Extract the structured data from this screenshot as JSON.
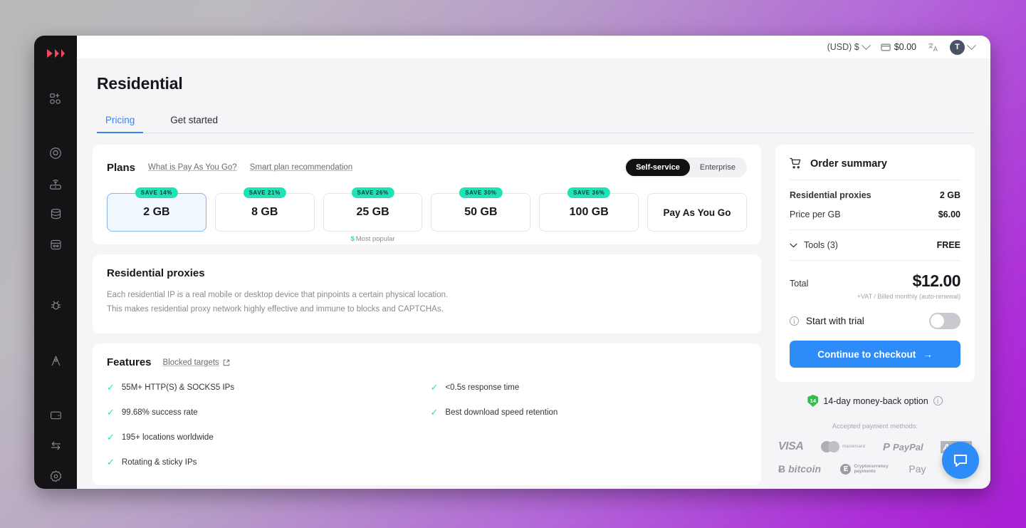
{
  "topbar": {
    "currency": "(USD) $",
    "balance": "$0.00",
    "language_icon": "translate-icon",
    "avatar_initial": "T"
  },
  "sidebar": {
    "logo": "brand-logo",
    "items": [
      {
        "icon": "add-user-icon",
        "name": "sidebar-item-add-user"
      },
      {
        "icon": "target-location-icon",
        "name": "sidebar-item-proxies"
      },
      {
        "icon": "router-icon",
        "name": "sidebar-item-network"
      },
      {
        "icon": "database-icon",
        "name": "sidebar-item-datacenter"
      },
      {
        "icon": "scraper-icon",
        "name": "sidebar-item-scraper"
      },
      {
        "icon": "bug-icon",
        "name": "sidebar-item-debug"
      },
      {
        "icon": "compass-icon",
        "name": "sidebar-item-explore"
      },
      {
        "icon": "wallet-icon",
        "name": "sidebar-item-billing"
      },
      {
        "icon": "transfer-icon",
        "name": "sidebar-item-transfer"
      },
      {
        "icon": "gear-icon",
        "name": "sidebar-item-settings"
      }
    ]
  },
  "page": {
    "title": "Residential",
    "tabs": [
      {
        "label": "Pricing",
        "active": true
      },
      {
        "label": "Get started",
        "active": false
      }
    ]
  },
  "plans": {
    "title": "Plans",
    "links": [
      {
        "label": "What is Pay As You Go?"
      },
      {
        "label": "Smart plan recommendation"
      }
    ],
    "segments": [
      {
        "label": "Self-service",
        "active": true
      },
      {
        "label": "Enterprise",
        "active": false
      }
    ],
    "options": [
      {
        "label": "2 GB",
        "badge": "SAVE 14%",
        "selected": true,
        "note": ""
      },
      {
        "label": "8 GB",
        "badge": "SAVE 21%",
        "selected": false,
        "note": ""
      },
      {
        "label": "25 GB",
        "badge": "SAVE 26%",
        "selected": false,
        "note": "Most popular"
      },
      {
        "label": "50 GB",
        "badge": "SAVE 30%",
        "selected": false,
        "note": ""
      },
      {
        "label": "100 GB",
        "badge": "SAVE 36%",
        "selected": false,
        "note": ""
      },
      {
        "label": "Pay As You Go",
        "badge": "",
        "selected": false,
        "note": ""
      }
    ]
  },
  "product": {
    "title": "Residential proxies",
    "line1": "Each residential IP is a real mobile or desktop device that pinpoints a certain physical location.",
    "line2": "This makes residential proxy network highly effective and immune to blocks and CAPTCHAs."
  },
  "features": {
    "title": "Features",
    "link": "Blocked targets",
    "items": [
      "55M+ HTTP(S) & SOCKS5 IPs",
      "<0.5s response time",
      "99.68% success rate",
      "Best download speed retention",
      "195+ locations worldwide",
      "Rotating & sticky IPs"
    ]
  },
  "order": {
    "title": "Order summary",
    "product_label": "Residential proxies",
    "product_value": "2 GB",
    "price_label": "Price per GB",
    "price_value": "$6.00",
    "tools_label": "Tools (3)",
    "tools_value": "FREE",
    "total_label": "Total",
    "total_value": "$12.00",
    "vat_note": "+VAT / Billed monthly (auto-renewal)",
    "trial_label": "Start with trial",
    "cta_label": "Continue to checkout",
    "cta_arrow": "→",
    "money_back": "14-day money-back option",
    "money_back_days": "14"
  },
  "payments": {
    "title": "Accepted payment methods:",
    "methods": [
      {
        "name": "visa",
        "label": "VISA"
      },
      {
        "name": "mastercard",
        "label": "mastercard"
      },
      {
        "name": "paypal",
        "label": "PayPal"
      },
      {
        "name": "amex",
        "label": "AMEX"
      },
      {
        "name": "bitcoin",
        "label": "bitcoin"
      },
      {
        "name": "crypto",
        "label": "Cryptocurrency payments",
        "l1": "Cryptocurrency",
        "l2": "payments"
      },
      {
        "name": "apple-pay",
        "label": "Pay"
      },
      {
        "name": "google-pay",
        "label": "Pay"
      }
    ]
  },
  "colors": {
    "accent_blue": "#2d8cf8",
    "badge_teal": "#1fe3b5",
    "sidebar_bg": "#141416",
    "logo_red": "#f4475f"
  }
}
